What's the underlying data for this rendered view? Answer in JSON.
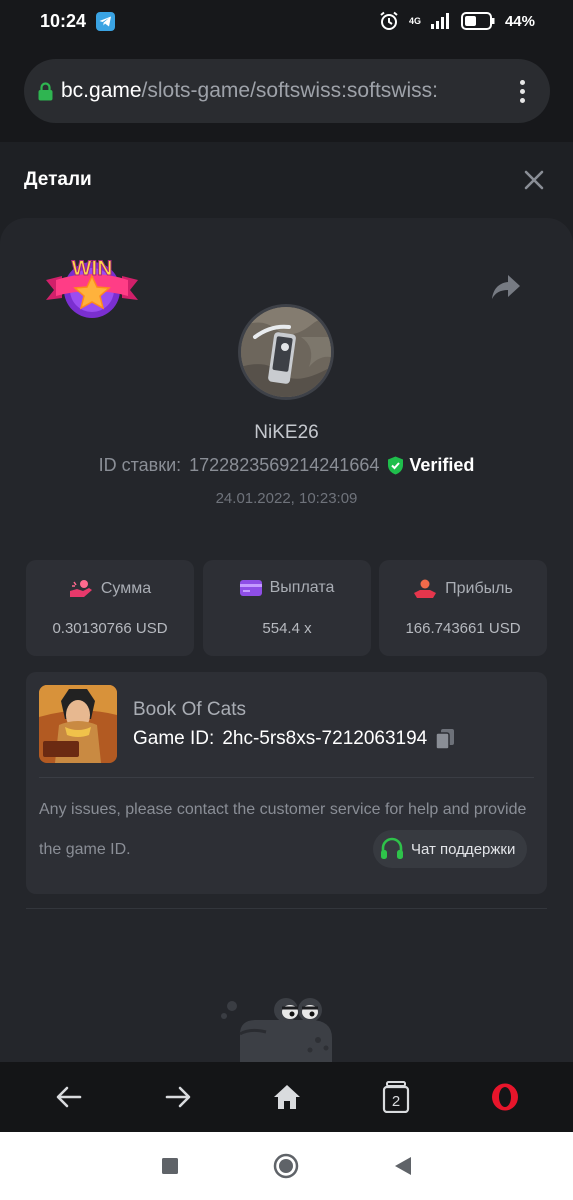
{
  "status_bar": {
    "time": "10:24",
    "network": "4G",
    "battery": "44%"
  },
  "browser": {
    "url_host": "bc.game",
    "url_path": "/slots-game/softswiss:softswiss:"
  },
  "modal": {
    "title": "Детали"
  },
  "bet": {
    "username": "NiKE26",
    "bet_id_label": "ID ставки:",
    "bet_id": "1722823569214241664",
    "verified": "Verified",
    "datetime": "24.01.2022, 10:23:09"
  },
  "stats": [
    {
      "label": "Сумма",
      "value": "0.30130766 USD"
    },
    {
      "label": "Выплата",
      "value": "554.4 x"
    },
    {
      "label": "Прибыль",
      "value": "166.743661 USD"
    }
  ],
  "game": {
    "name": "Book Of Cats",
    "game_id_label": "Game ID:",
    "game_id": "2hc-5rs8xs-7212063194",
    "notice": "Any issues, please contact the customer service for help and provide the game ID.",
    "support_label": "Чат поддержки"
  },
  "badge": {
    "text": "WIN"
  },
  "browser_nav": {
    "tabs_count": "2"
  },
  "colors": {
    "verified": "#1fbe4c",
    "support_icon": "#2ec24a",
    "opera": "#e8152b"
  }
}
